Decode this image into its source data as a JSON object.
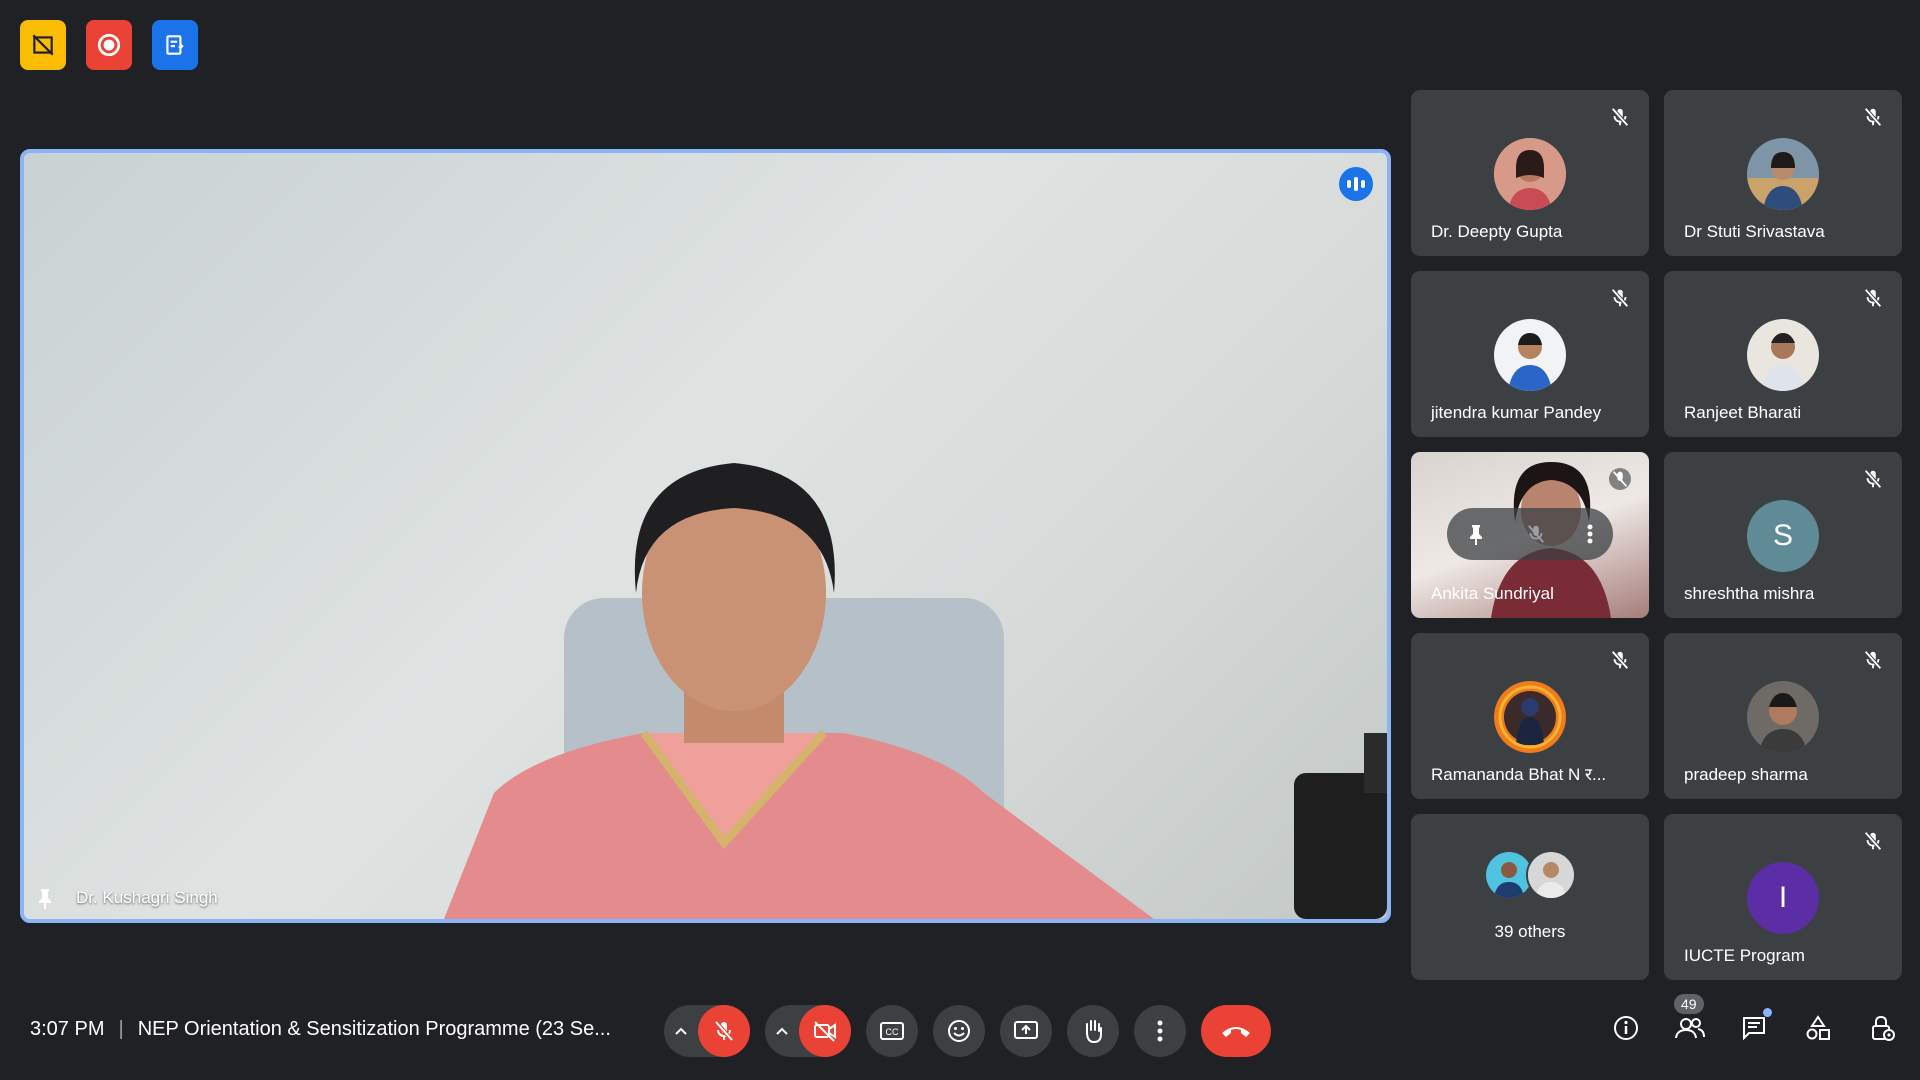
{
  "top_icons": [
    {
      "name": "no-camera-badge-icon",
      "color": "#fbbc04"
    },
    {
      "name": "recording-icon",
      "color": "#ea4335"
    },
    {
      "name": "notes-icon",
      "color": "#1a73e8"
    }
  ],
  "main_speaker": {
    "name": "Dr. Kushagri Singh",
    "speaking": true,
    "pinned": true
  },
  "participants": [
    {
      "name": "Dr. Deepty Gupta",
      "muted": true,
      "avatar": "photo"
    },
    {
      "name": "Dr Stuti Srivastava",
      "muted": true,
      "avatar": "photo"
    },
    {
      "name": "jitendra kumar Pandey",
      "muted": true,
      "avatar": "photo"
    },
    {
      "name": "Ranjeet Bharati",
      "muted": true,
      "avatar": "photo"
    },
    {
      "name": "Ankita Sundriyal",
      "muted": true,
      "avatar": "video"
    },
    {
      "name": "shreshtha mishra",
      "muted": true,
      "avatar_letter": "S",
      "avatar_color": "#5f8b97"
    },
    {
      "name": "Ramananda Bhat N र...",
      "muted": true,
      "avatar": "photo"
    },
    {
      "name": "pradeep sharma",
      "muted": true,
      "avatar": "photo"
    },
    {
      "name": "39 others",
      "muted": false,
      "avatar": "group"
    },
    {
      "name": "IUCTE Program",
      "muted": true,
      "avatar_letter": "I",
      "avatar_color": "#5b2ea6"
    }
  ],
  "bottom_bar": {
    "time": "3:07 PM",
    "separator": "|",
    "meeting_title": "NEP Orientation & Sensitization Programme (23 Se...",
    "people_count": "49",
    "controls": [
      "mic-off",
      "camera-off",
      "captions",
      "emoji",
      "present",
      "raise-hand",
      "more",
      "end-call"
    ]
  }
}
